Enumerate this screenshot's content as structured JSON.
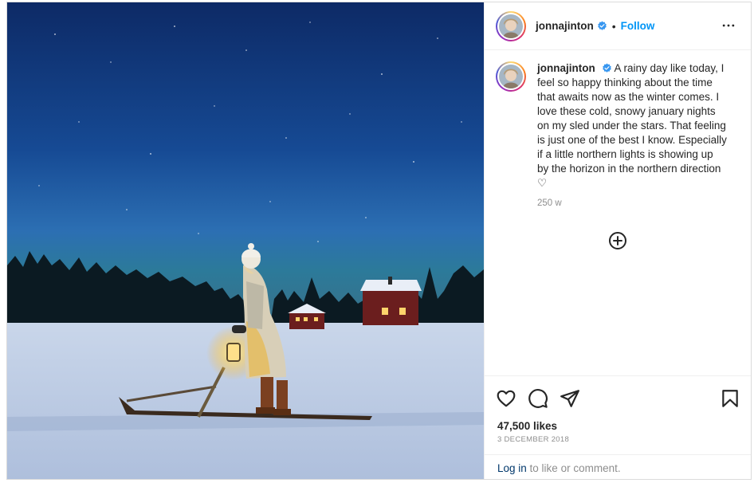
{
  "post": {
    "username": "jonnajinton",
    "follow_label": "Follow",
    "separator": "•",
    "caption": "A rainy day like today, I feel so happy thinking about the time that awaits now as the winter comes. I love these cold, snowy january nights on my sled under the stars. That feeling is just one of the best I know. Especially if a little northern lights is showing up by the horizon in the northern direction ♡",
    "caption_time": "250 w",
    "likes": "47,500 likes",
    "date": "3 DECEMBER 2018",
    "login_link": "Log in",
    "login_suffix": " to like or comment."
  },
  "icons": {
    "verified": "verified-badge-icon",
    "more": "more-options-icon",
    "add_comment": "add-circle-icon",
    "like": "heart-icon",
    "comment": "comment-icon",
    "share": "paper-plane-icon",
    "save": "bookmark-icon"
  },
  "colors": {
    "follow": "#0095f6",
    "verified": "#3897f0",
    "muted": "#8e8e8e",
    "link": "#00376b"
  }
}
